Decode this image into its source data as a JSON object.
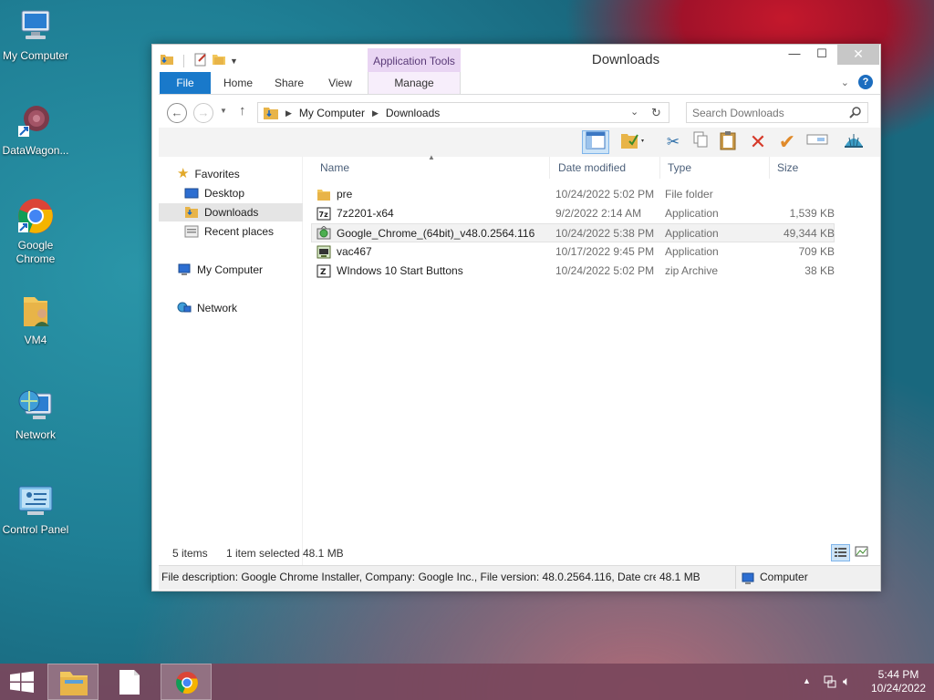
{
  "desktop": {
    "icons": [
      {
        "label": "My Computer",
        "icon": "computer-icon"
      },
      {
        "label": "DataWagon...",
        "icon": "datawagon-icon"
      },
      {
        "label": "Google Chrome",
        "icon": "chrome-icon"
      },
      {
        "label": "VM4",
        "icon": "user-folder-icon"
      },
      {
        "label": "Network",
        "icon": "network-icon"
      },
      {
        "label": "Control Panel",
        "icon": "control-panel-icon"
      }
    ]
  },
  "window": {
    "title": "Downloads",
    "context_tab": "Application Tools",
    "ribbon_tabs": [
      "File",
      "Home",
      "Share",
      "View",
      "Manage"
    ],
    "controls": {
      "minimize": "—",
      "maximize": "☐",
      "close": "✕"
    }
  },
  "address": {
    "crumbs": [
      "My Computer",
      "Downloads"
    ],
    "search_placeholder": "Search Downloads"
  },
  "nav_pane": {
    "favorites_label": "Favorites",
    "favorites": [
      "Desktop",
      "Downloads",
      "Recent places"
    ],
    "computer": "My Computer",
    "network": "Network",
    "selected": "Downloads"
  },
  "columns": {
    "name": "Name",
    "date": "Date modified",
    "type": "Type",
    "size": "Size"
  },
  "files": [
    {
      "name": "pre",
      "date": "10/24/2022 5:02 PM",
      "type": "File folder",
      "size": "",
      "icon": "folder-icon"
    },
    {
      "name": "7z2201-x64",
      "date": "9/2/2022 2:14 AM",
      "type": "Application",
      "size": "1,539 KB",
      "icon": "7zip-icon"
    },
    {
      "name": "Google_Chrome_(64bit)_v48.0.2564.116",
      "date": "10/24/2022 5:38 PM",
      "type": "Application",
      "size": "49,344 KB",
      "icon": "installer-icon"
    },
    {
      "name": "vac467",
      "date": "10/17/2022 9:45 PM",
      "type": "Application",
      "size": "709 KB",
      "icon": "app-icon"
    },
    {
      "name": "WIndows 10 Start Buttons",
      "date": "10/24/2022 5:02 PM",
      "type": "zip Archive",
      "size": "38 KB",
      "icon": "archive-icon"
    }
  ],
  "status": {
    "count": "5 items",
    "selected": "1 item selected",
    "size": "48.1 MB"
  },
  "description_bar": {
    "text": "File description: Google Chrome Installer, Company: Google Inc., File version: 48.0.2564.116, Date create",
    "size": "48.1 MB",
    "zone": "Computer"
  },
  "taskbar": {
    "time": "5:44 PM",
    "date": "10/24/2022"
  },
  "colors": {
    "file_tab": "#1979ca",
    "context_tab": "#e9d5f3",
    "taskbar": "#7a465c"
  }
}
